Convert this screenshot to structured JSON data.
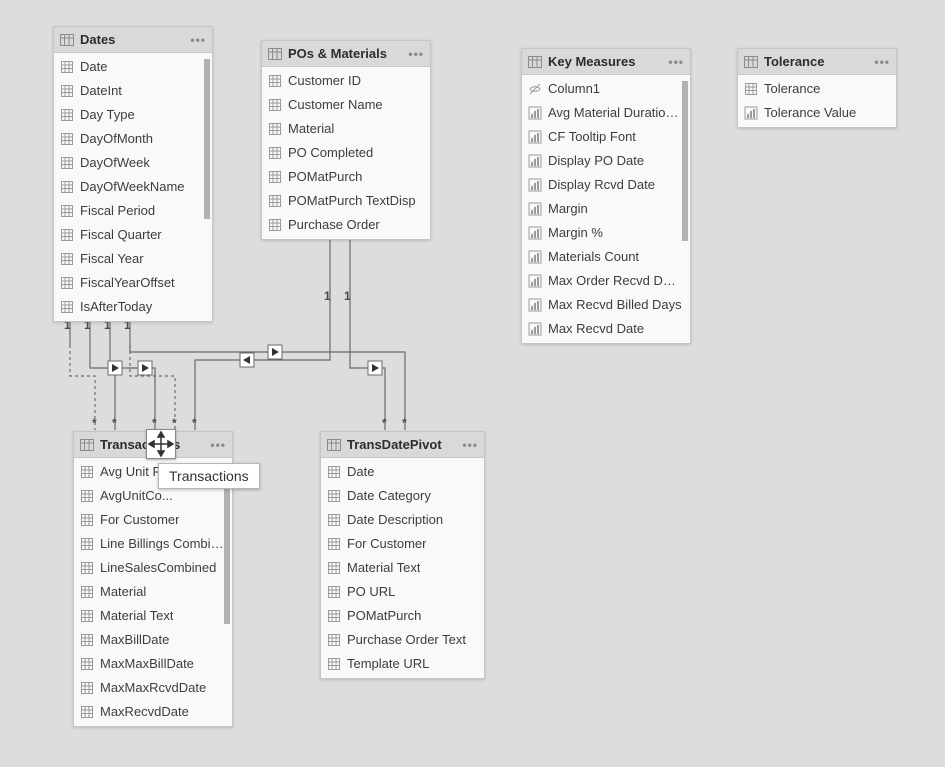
{
  "tables": {
    "dates": {
      "title": "Dates",
      "fields": [
        {
          "label": "Date",
          "icon": "col"
        },
        {
          "label": "DateInt",
          "icon": "col"
        },
        {
          "label": "Day Type",
          "icon": "col"
        },
        {
          "label": "DayOfMonth",
          "icon": "col"
        },
        {
          "label": "DayOfWeek",
          "icon": "col"
        },
        {
          "label": "DayOfWeekName",
          "icon": "col"
        },
        {
          "label": "Fiscal Period",
          "icon": "col"
        },
        {
          "label": "Fiscal Quarter",
          "icon": "col"
        },
        {
          "label": "Fiscal Year",
          "icon": "col"
        },
        {
          "label": "FiscalYearOffset",
          "icon": "col"
        },
        {
          "label": "IsAfterToday",
          "icon": "col"
        }
      ]
    },
    "pos": {
      "title": "POs & Materials",
      "fields": [
        {
          "label": "Customer ID",
          "icon": "col"
        },
        {
          "label": "Customer Name",
          "icon": "col"
        },
        {
          "label": "Material",
          "icon": "col"
        },
        {
          "label": "PO Completed",
          "icon": "col"
        },
        {
          "label": "POMatPurch",
          "icon": "col"
        },
        {
          "label": "POMatPurch TextDisp",
          "icon": "col"
        },
        {
          "label": "Purchase Order",
          "icon": "col"
        }
      ]
    },
    "keymeasures": {
      "title": "Key Measures",
      "fields": [
        {
          "label": "Column1",
          "icon": "hidden"
        },
        {
          "label": "Avg Material Duration...",
          "icon": "measure"
        },
        {
          "label": "CF Tooltip Font",
          "icon": "measure"
        },
        {
          "label": "Display PO Date",
          "icon": "measure"
        },
        {
          "label": "Display Rcvd Date",
          "icon": "measure"
        },
        {
          "label": "Margin",
          "icon": "measure"
        },
        {
          "label": "Margin %",
          "icon": "measure"
        },
        {
          "label": "Materials Count",
          "icon": "measure"
        },
        {
          "label": "Max Order Recvd Days",
          "icon": "measure"
        },
        {
          "label": "Max Recvd Billed Days",
          "icon": "measure"
        },
        {
          "label": "Max Recvd Date",
          "icon": "measure"
        }
      ]
    },
    "tolerance": {
      "title": "Tolerance",
      "fields": [
        {
          "label": "Tolerance",
          "icon": "col"
        },
        {
          "label": "Tolerance Value",
          "icon": "measure"
        }
      ]
    },
    "transactions": {
      "title": "Transactions",
      "fields": [
        {
          "label": "Avg Unit P...",
          "icon": "col"
        },
        {
          "label": "AvgUnitCo...",
          "icon": "col"
        },
        {
          "label": "For Customer",
          "icon": "col"
        },
        {
          "label": "Line Billings Combined",
          "icon": "col"
        },
        {
          "label": "LineSalesCombined",
          "icon": "col"
        },
        {
          "label": "Material",
          "icon": "col"
        },
        {
          "label": "Material Text",
          "icon": "col"
        },
        {
          "label": "MaxBillDate",
          "icon": "col"
        },
        {
          "label": "MaxMaxBillDate",
          "icon": "col"
        },
        {
          "label": "MaxMaxRcvdDate",
          "icon": "col"
        },
        {
          "label": "MaxRecvdDate",
          "icon": "col"
        }
      ]
    },
    "transdatepivot": {
      "title": "TransDatePivot",
      "fields": [
        {
          "label": "Date",
          "icon": "col"
        },
        {
          "label": "Date Category",
          "icon": "col"
        },
        {
          "label": "Date Description",
          "icon": "col"
        },
        {
          "label": "For Customer",
          "icon": "col"
        },
        {
          "label": "Material Text",
          "icon": "col"
        },
        {
          "label": "PO URL",
          "icon": "col"
        },
        {
          "label": "POMatPurch",
          "icon": "col"
        },
        {
          "label": "Purchase Order Text",
          "icon": "col"
        },
        {
          "label": "Template URL",
          "icon": "col"
        }
      ]
    }
  },
  "tooltip": {
    "label": "Transactions"
  },
  "cardinality": {
    "dates_out": [
      "1",
      "1",
      "1",
      "1"
    ],
    "pos_out": [
      "1",
      "1"
    ],
    "trans_in": [
      "*",
      "*",
      "*",
      "*",
      "*"
    ],
    "tdp_in": [
      "*",
      "*"
    ]
  }
}
